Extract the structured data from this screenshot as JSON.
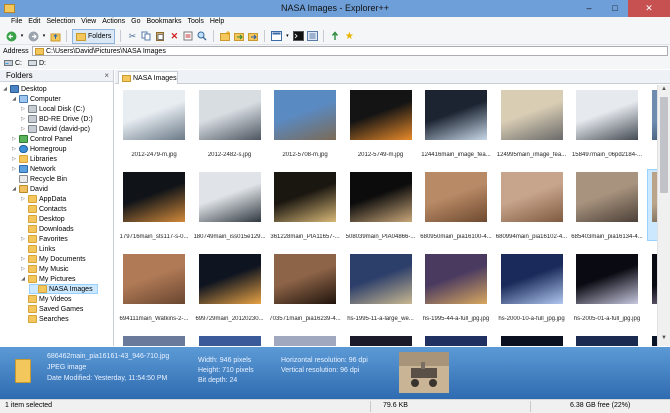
{
  "window": {
    "title": "NASA Images - Explorer++",
    "minimize": "–",
    "maximize": "□",
    "close": "✕"
  },
  "menu": [
    "File",
    "Edit",
    "Selection",
    "View",
    "Actions",
    "Go",
    "Bookmarks",
    "Tools",
    "Help"
  ],
  "toolbar": {
    "folders_label": "Folders"
  },
  "address": {
    "label": "Address",
    "path": "C:\\Users\\David\\Pictures\\NASA Images"
  },
  "drives": [
    "C:",
    "D:"
  ],
  "folders_pane": {
    "title": "Folders",
    "close": "×",
    "items": [
      {
        "label": "Desktop",
        "icon": "desktop-icon",
        "level": 0,
        "expander": "◢"
      },
      {
        "label": "Computer",
        "icon": "computer-icon",
        "level": 1,
        "expander": "◢"
      },
      {
        "label": "Local Disk (C:)",
        "icon": "drive-icon",
        "level": 2,
        "expander": "▷"
      },
      {
        "label": "BD-RE Drive (D:)",
        "icon": "drive-icon",
        "level": 2,
        "expander": "▷"
      },
      {
        "label": "David (david-pc)",
        "icon": "drive-icon",
        "level": 2,
        "expander": "▷"
      },
      {
        "label": "Control Panel",
        "icon": "control-panel-icon",
        "level": 1,
        "expander": "▷"
      },
      {
        "label": "Homegroup",
        "icon": "homegroup-icon",
        "level": 1,
        "expander": "▷"
      },
      {
        "label": "Libraries",
        "icon": "folder-icon",
        "level": 1,
        "expander": "▷"
      },
      {
        "label": "Network",
        "icon": "network-icon",
        "level": 1,
        "expander": "▷"
      },
      {
        "label": "Recycle Bin",
        "icon": "recycle-bin-icon",
        "level": 1,
        "expander": ""
      },
      {
        "label": "David",
        "icon": "user-folder-icon",
        "level": 1,
        "expander": "◢"
      },
      {
        "label": "AppData",
        "icon": "folder-icon",
        "level": 2,
        "expander": "▷"
      },
      {
        "label": "Contacts",
        "icon": "folder-icon",
        "level": 2,
        "expander": ""
      },
      {
        "label": "Desktop",
        "icon": "folder-icon",
        "level": 2,
        "expander": ""
      },
      {
        "label": "Downloads",
        "icon": "folder-icon",
        "level": 2,
        "expander": ""
      },
      {
        "label": "Favorites",
        "icon": "folder-icon",
        "level": 2,
        "expander": "▷"
      },
      {
        "label": "Links",
        "icon": "folder-icon",
        "level": 2,
        "expander": ""
      },
      {
        "label": "My Documents",
        "icon": "folder-icon",
        "level": 2,
        "expander": "▷"
      },
      {
        "label": "My Music",
        "icon": "folder-icon",
        "level": 2,
        "expander": "▷"
      },
      {
        "label": "My Pictures",
        "icon": "folder-icon",
        "level": 2,
        "expander": "◢"
      },
      {
        "label": "NASA Images",
        "icon": "folder-icon",
        "level": 3,
        "expander": "",
        "selected": true
      },
      {
        "label": "My Videos",
        "icon": "folder-icon",
        "level": 2,
        "expander": ""
      },
      {
        "label": "Saved Games",
        "icon": "folder-icon",
        "level": 2,
        "expander": ""
      },
      {
        "label": "Searches",
        "icon": "folder-icon",
        "level": 2,
        "expander": ""
      }
    ]
  },
  "tab": {
    "label": "NASA Images"
  },
  "files": [
    {
      "name": "2012-2479-m.jpg",
      "colors": [
        "#e8edf2",
        "#6b7a88"
      ]
    },
    {
      "name": "2012-2482-s.jpg",
      "colors": [
        "#d8dde2",
        "#4d5661"
      ]
    },
    {
      "name": "2012-5708-m.jpg",
      "colors": [
        "#5a8ac2",
        "#7a6a56"
      ]
    },
    {
      "name": "2012-5749-m.jpg",
      "colors": [
        "#141414",
        "#e88a2a"
      ]
    },
    {
      "name": "124416main_image_fea...",
      "colors": [
        "#1c2432",
        "#c8d8e8"
      ]
    },
    {
      "name": "124995main_image_fea...",
      "colors": [
        "#d9cdb4",
        "#6a6a6a"
      ]
    },
    {
      "name": "158497main_06pd2184-...",
      "colors": [
        "#e6eaef",
        "#444a52"
      ]
    },
    {
      "name": "1624...",
      "colors": [
        "#6d8cb0",
        "#2a3a4e"
      ]
    },
    {
      "name": "179716main_sts117-s-0...",
      "colors": [
        "#101418",
        "#d28a3a"
      ]
    },
    {
      "name": "180749main_iss015e129...",
      "colors": [
        "#e0e4e8",
        "#303840"
      ]
    },
    {
      "name": "361228main_PIA11657-...",
      "colors": [
        "#1a1610",
        "#d8b878"
      ]
    },
    {
      "name": "508039main_PIA04866-...",
      "colors": [
        "#0c0c0c",
        "#c9a77a"
      ]
    },
    {
      "name": "680950main_pia16100-4...",
      "colors": [
        "#b98a66",
        "#6e4a30"
      ]
    },
    {
      "name": "680994main_pia16102-4...",
      "colors": [
        "#c7a58c",
        "#7e5a40"
      ]
    },
    {
      "name": "685403main_pia16134-4...",
      "colors": [
        "#a8937e",
        "#4c4038"
      ]
    },
    {
      "name": "68646...",
      "colors": [
        "#b9a48a",
        "#4e4032"
      ],
      "selected": true
    },
    {
      "name": "694111main_Watkins-2-...",
      "colors": [
        "#b07a56",
        "#6a4630"
      ]
    },
    {
      "name": "699729main_20120230...",
      "colors": [
        "#0e1420",
        "#e8a244"
      ]
    },
    {
      "name": "703571main_pia16239-4...",
      "colors": [
        "#8e6448",
        "#20140c"
      ]
    },
    {
      "name": "hs-1995-11-a-large_we...",
      "colors": [
        "#2c3e6a",
        "#c8b890"
      ]
    },
    {
      "name": "hs-1995-44-a-full_jpg.jpg",
      "colors": [
        "#4a3a60",
        "#d8a860"
      ]
    },
    {
      "name": "hs-2000-10-a-full_jpg.jpg",
      "colors": [
        "#1a2a5a",
        "#b0c8f0"
      ]
    },
    {
      "name": "hs-2005-01-a-full_jpg.jpg",
      "colors": [
        "#0a0a12",
        "#c8c8e0"
      ]
    },
    {
      "name": "hs-2...",
      "colors": [
        "#0a0a14",
        "#b0a0c0"
      ]
    },
    {
      "name": "",
      "colors": [
        "#6a7a9a",
        "#c8d4e4"
      ]
    },
    {
      "name": "",
      "colors": [
        "#3a5a9a",
        "#dca070"
      ]
    },
    {
      "name": "",
      "colors": [
        "#a0a8c0",
        "#3a4a7a"
      ]
    },
    {
      "name": "",
      "colors": [
        "#1a1a2a",
        "#d0c0a0"
      ]
    },
    {
      "name": "",
      "colors": [
        "#203060",
        "#a0c0e0"
      ]
    },
    {
      "name": "",
      "colors": [
        "#0a1020",
        "#6080c0"
      ]
    },
    {
      "name": "",
      "colors": [
        "#1a2a50",
        "#80a0d0"
      ]
    },
    {
      "name": "",
      "colors": [
        "#0a1428",
        "#5078b8"
      ]
    }
  ],
  "info": {
    "filename": "686462main_pia16161-43_946-710.jpg",
    "type": "JPEG image",
    "modified": "Date Modified: Yesterday, 11:54:50 PM",
    "width": "Width: 946 pixels",
    "height": "Height: 710 pixels",
    "bitdepth": "Bit depth: 24",
    "hres": "Horizontal resolution: 96 dpi",
    "vres": "Vertical resolution: 96 dpi"
  },
  "status": {
    "selection": "1 item selected",
    "size": "79.6 KB",
    "free": "6.38 GB free (22%)"
  }
}
